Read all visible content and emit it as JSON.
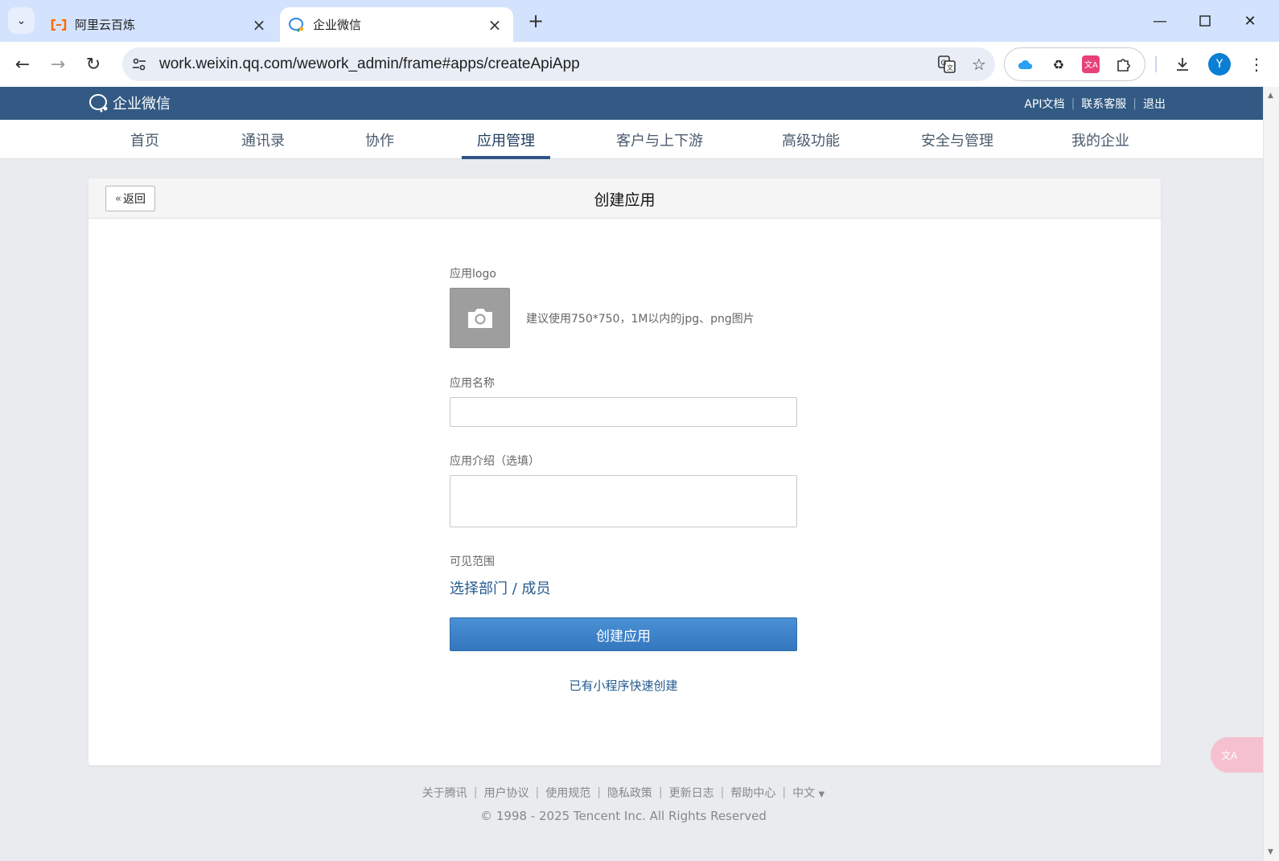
{
  "browser": {
    "tabs": [
      {
        "title": "阿里云百炼",
        "active": false,
        "icon": "aliyun-icon"
      },
      {
        "title": "企业微信",
        "active": true,
        "icon": "wework-icon"
      }
    ],
    "url": "work.weixin.qq.com/wework_admin/frame#apps/createApiApp",
    "avatar_letter": "Y"
  },
  "header": {
    "logo_text": "企业微信",
    "links": [
      "API文档",
      "联系客服",
      "退出"
    ]
  },
  "nav": {
    "items": [
      "首页",
      "通讯录",
      "协作",
      "应用管理",
      "客户与上下游",
      "高级功能",
      "安全与管理",
      "我的企业"
    ],
    "active": "应用管理"
  },
  "card": {
    "back_label": "返回",
    "title": "创建应用"
  },
  "form": {
    "logo_label": "应用logo",
    "logo_hint": "建议使用750*750，1M以内的jpg、png图片",
    "name_label": "应用名称",
    "name_value": "",
    "intro_label": "应用介绍（选填）",
    "intro_value": "",
    "scope_label": "可见范围",
    "scope_link": "选择部门 / 成员",
    "submit_label": "创建应用",
    "mini_program_link": "已有小程序快速创建"
  },
  "footer": {
    "links": [
      "关于腾讯",
      "用户协议",
      "使用规范",
      "隐私政策",
      "更新日志",
      "帮助中心",
      "中文"
    ],
    "copyright": "© 1998 - 2025 Tencent Inc. All Rights Reserved"
  },
  "colors": {
    "header_bg": "#325a84",
    "nav_active": "#2f5486",
    "button_bg": "#3a80c8",
    "link": "#255a8f"
  }
}
